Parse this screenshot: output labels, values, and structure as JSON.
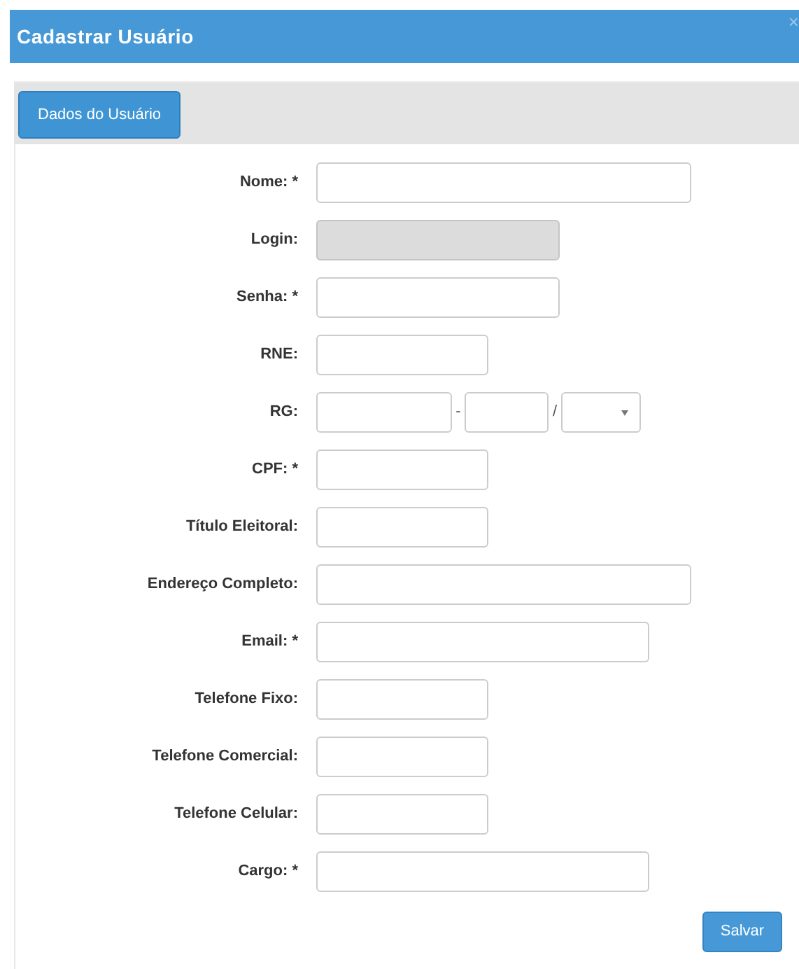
{
  "window": {
    "title": "Cadastrar Usuário",
    "close": "×"
  },
  "tabs": [
    {
      "label": "Dados do Usuário",
      "selected": true
    }
  ],
  "fields": [
    {
      "kind": "text",
      "label": "Nome: *",
      "disabled": false
    },
    {
      "kind": "text",
      "label": "Login:",
      "disabled": true
    },
    {
      "kind": "text",
      "label": "Senha: *",
      "disabled": false
    },
    {
      "kind": "text",
      "label": "RNE:",
      "disabled": false
    },
    {
      "kind": "rg",
      "label": "RG:",
      "separators": [
        "-",
        "/"
      ],
      "disabled": false
    },
    {
      "kind": "text",
      "label": "CPF: *",
      "disabled": false
    },
    {
      "kind": "text",
      "label": "Título Eleitoral:",
      "disabled": false
    },
    {
      "kind": "text",
      "label": "Endereço Completo:",
      "disabled": false
    },
    {
      "kind": "text",
      "label": "Email: *",
      "disabled": false
    },
    {
      "kind": "text",
      "label": "Telefone Fixo:",
      "disabled": false
    },
    {
      "kind": "text",
      "label": "Telefone Comercial:",
      "disabled": false
    },
    {
      "kind": "text",
      "label": "Telefone Celular:",
      "disabled": false
    },
    {
      "kind": "text",
      "label": "Cargo: *",
      "disabled": false
    }
  ],
  "buttons": [
    {
      "label": "Salvar"
    }
  ]
}
